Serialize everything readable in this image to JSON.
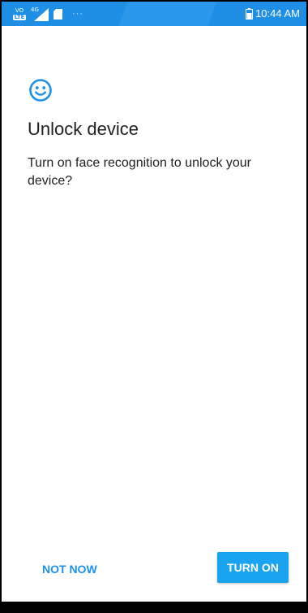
{
  "status_bar": {
    "volte_label": "VO",
    "lte_label": "LTE",
    "network_label": "4G",
    "overflow_dots": "···",
    "time": "10:44 AM",
    "background_color": "#1f8fe6"
  },
  "dialog": {
    "icon": "face-smile-icon",
    "accent_color": "#1e90e8",
    "title": "Unlock device",
    "description": "Turn on face recognition to unlock your device?",
    "not_now_label": "NOT NOW",
    "turn_on_label": "TURN ON"
  }
}
